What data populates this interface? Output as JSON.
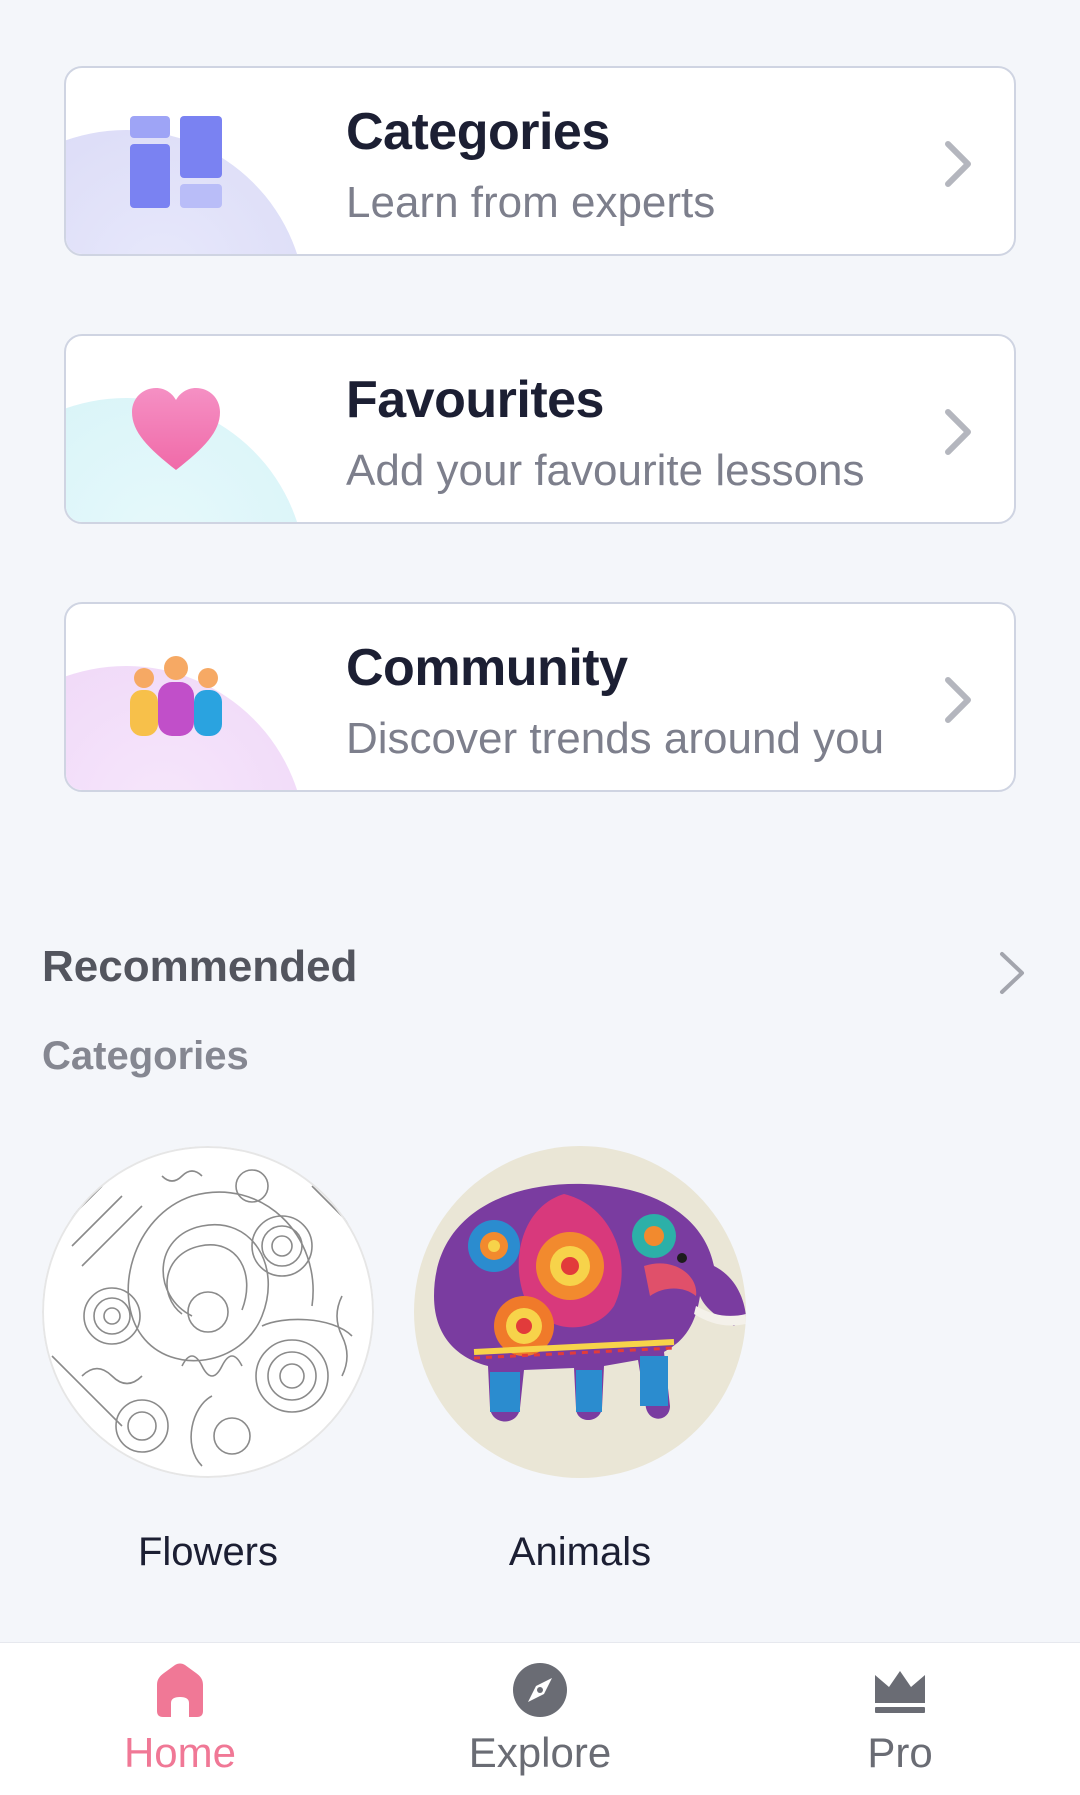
{
  "cards": [
    {
      "title": "Categories",
      "subtitle": "Learn from experts",
      "icon": "grid-icon"
    },
    {
      "title": "Favourites",
      "subtitle": "Add your favourite lessons",
      "icon": "heart-icon"
    },
    {
      "title": "Community",
      "subtitle": "Discover trends around you",
      "icon": "people-icon"
    }
  ],
  "recommended": {
    "title": "Recommended",
    "subtitle": "Categories",
    "items": [
      {
        "label": "Flowers"
      },
      {
        "label": "Animals"
      }
    ]
  },
  "tabbar": {
    "home": "Home",
    "explore": "Explore",
    "pro": "Pro",
    "active": "home"
  },
  "colors": {
    "accent": "#f07896",
    "inactive": "#6a6c74",
    "background": "#f4f6fa"
  }
}
